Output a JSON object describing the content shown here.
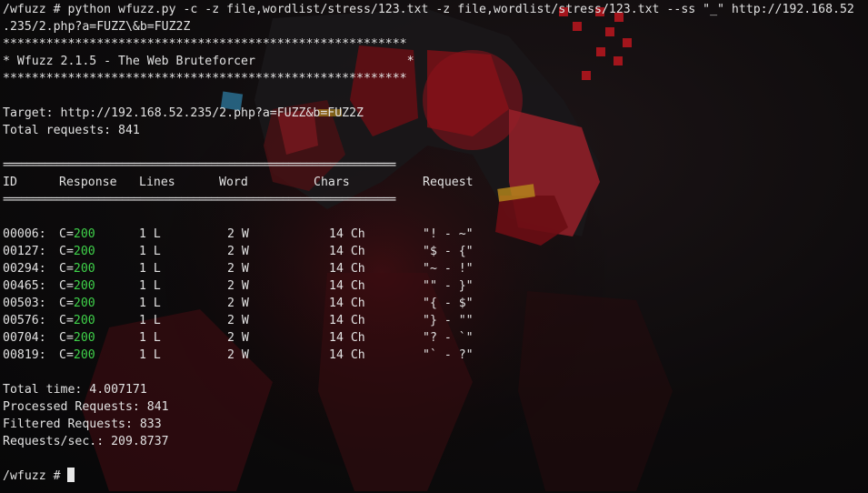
{
  "command": {
    "line1": "/wfuzz # python wfuzz.py -c -z file,wordlist/stress/123.txt -z file,wordlist/stress/123.txt --ss \"_\" http://192.168.52",
    "line2": ".235/2.php?a=FUZZ\\&b=FUZ2Z"
  },
  "banner": {
    "stars": "********************************************************",
    "title": "* Wfuzz 2.1.5 - The Web Bruteforcer                     *"
  },
  "summary": {
    "target": "Target: http://192.168.52.235/2.php?a=FUZZ&b=FUZ2Z",
    "total_requests": "Total requests: 841"
  },
  "rule": "==================================================================",
  "table": {
    "headers": {
      "id": "ID",
      "response": "Response",
      "lines": "Lines",
      "word": "Word",
      "chars": "Chars",
      "request": "Request"
    },
    "rows": [
      {
        "id": "00006:",
        "prefix": "C=",
        "code": "200",
        "lines": "1 L",
        "word": "2 W",
        "chars": "14 Ch",
        "request": "\"! - ~\""
      },
      {
        "id": "00127:",
        "prefix": "C=",
        "code": "200",
        "lines": "1 L",
        "word": "2 W",
        "chars": "14 Ch",
        "request": "\"$ - {\""
      },
      {
        "id": "00294:",
        "prefix": "C=",
        "code": "200",
        "lines": "1 L",
        "word": "2 W",
        "chars": "14 Ch",
        "request": "\"~ - !\""
      },
      {
        "id": "00465:",
        "prefix": "C=",
        "code": "200",
        "lines": "1 L",
        "word": "2 W",
        "chars": "14 Ch",
        "request": "\"\" - }\""
      },
      {
        "id": "00503:",
        "prefix": "C=",
        "code": "200",
        "lines": "1 L",
        "word": "2 W",
        "chars": "14 Ch",
        "request": "\"{ - $\""
      },
      {
        "id": "00576:",
        "prefix": "C=",
        "code": "200",
        "lines": "1 L",
        "word": "2 W",
        "chars": "14 Ch",
        "request": "\"} - \"\""
      },
      {
        "id": "00704:",
        "prefix": "C=",
        "code": "200",
        "lines": "1 L",
        "word": "2 W",
        "chars": "14 Ch",
        "request": "\"? - `\""
      },
      {
        "id": "00819:",
        "prefix": "C=",
        "code": "200",
        "lines": "1 L",
        "word": "2 W",
        "chars": "14 Ch",
        "request": "\"` - ?\""
      }
    ]
  },
  "stats": {
    "total_time": "Total time: 4.007171",
    "processed": "Processed Requests: 841",
    "filtered": "Filtered Requests: 833",
    "rate": "Requests/sec.: 209.8737"
  },
  "prompt": "/wfuzz # ",
  "colors": {
    "background": "#0b0b0d",
    "text": "#e2e2e2",
    "status_code": "#3fd24a",
    "art_red": "#b3161e"
  }
}
